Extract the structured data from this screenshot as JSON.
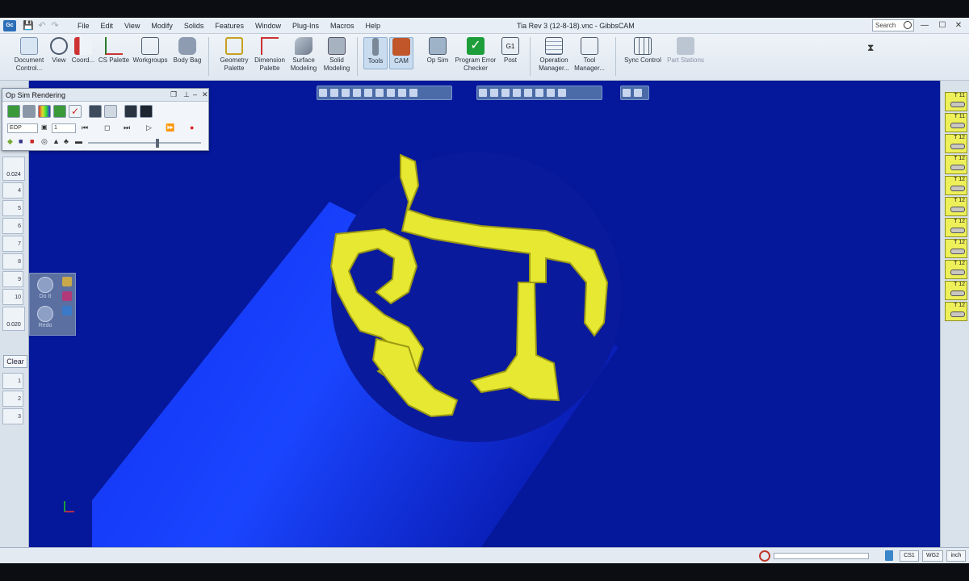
{
  "window": {
    "title": "Tia Rev 3 (12-8-18).vnc - GibbsCAM",
    "app_logo": "Gc",
    "search_placeholder": "Search",
    "controls": {
      "minimize": "—",
      "maximize": "☐",
      "close": "✕"
    }
  },
  "quick_access": {
    "save": "💾",
    "undo": "↶",
    "redo": "↷"
  },
  "menu": [
    "File",
    "Edit",
    "View",
    "Modify",
    "Solids",
    "Features",
    "Window",
    "Plug-Ins",
    "Macros",
    "Help"
  ],
  "ribbon": {
    "document_control": "Document Control...",
    "view": "View",
    "coord": "Coord...",
    "cs_palette": "CS Palette",
    "workgroups": "Workgroups",
    "body_bag": "Body Bag",
    "geometry_palette": "Geometry Palette",
    "dimension_palette": "Dimension Palette",
    "surface_modeling": "Surface Modeling",
    "solid_modeling": "Solid Modeling",
    "tools": "Tools",
    "cam": "CAM",
    "op_sim": "Op Sim",
    "program_error_checker": "Program Error Checker",
    "post": "Post",
    "post_badge": "G1",
    "operation_manager": "Operation Manager...",
    "tool_manager": "Tool Manager...",
    "sync_control": "Sync Control",
    "part_stations": "Part Stations"
  },
  "op_sim_window": {
    "title": "Op Sim Rendering",
    "mode_value": "EOP",
    "step_value": "1",
    "playback": {
      "rewind": "⏮",
      "stop": "◻",
      "step": "⏭",
      "play": "▷",
      "fast_forward": "⏩",
      "record": "●"
    },
    "speed_fraction": 0.62
  },
  "left_panel": {
    "tool_dims": [
      "0.024",
      "0.020"
    ],
    "slot_numbers": [
      "4",
      "5",
      "6",
      "7",
      "8",
      "9",
      "10",
      "1",
      "2",
      "3"
    ],
    "clear_label": "Clear",
    "do_it_label": "Do It",
    "redo_label": "Redo"
  },
  "right_panel": {
    "tool_labels": [
      "T 11",
      "T 11",
      "T 12",
      "T 12",
      "T 12",
      "T 12",
      "T 12",
      "T 12",
      "T 12",
      "T 12",
      "T 12"
    ]
  },
  "viewport": {
    "background_color": "#05179a",
    "stock_color": "#0a28e0",
    "part_face_color": "#0a1a9c",
    "feature_color": "#e6e832"
  },
  "status_bar": {
    "cs": "CS1",
    "wg": "WG2",
    "units": "inch",
    "progress_fraction": 0.0
  }
}
